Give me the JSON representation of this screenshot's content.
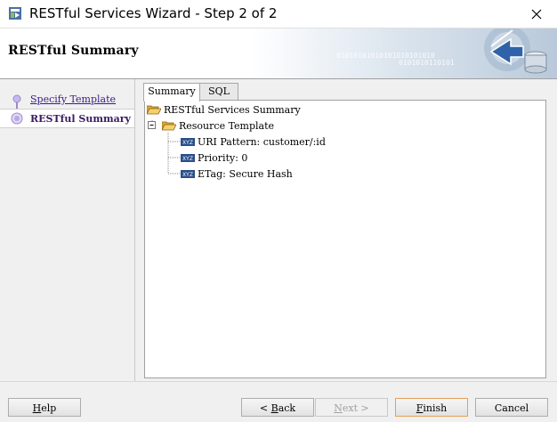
{
  "window": {
    "title": "RESTful Services Wizard - Step 2 of 2",
    "close_icon": "close-x-icon"
  },
  "banner": {
    "heading": "RESTful Summary",
    "binary_line_1": "01010101010101010101010",
    "binary_line_2": "0101010110101"
  },
  "steps": [
    {
      "label": "Specify Template",
      "state": "completed"
    },
    {
      "label": "RESTful Summary",
      "state": "current"
    }
  ],
  "tabs": [
    {
      "label": "Summary",
      "active": true
    },
    {
      "label": "SQL",
      "active": false
    }
  ],
  "tree": {
    "root": {
      "label": "RESTful Services Summary",
      "icon": "folder-open-icon"
    },
    "child": {
      "label": "Resource Template",
      "icon": "folder-open-icon",
      "expanded": true
    },
    "leaves": [
      {
        "label": "URI Pattern: customer/:id",
        "icon": "xyz-property-icon"
      },
      {
        "label": "Priority: 0",
        "icon": "xyz-property-icon"
      },
      {
        "label": "ETag: Secure Hash",
        "icon": "xyz-property-icon"
      }
    ],
    "xyz_icon_text": "XYZ"
  },
  "buttons": {
    "help": {
      "label": "Help",
      "mnemonic": "H",
      "rest": "elp"
    },
    "back": {
      "label": "< Back",
      "prefix": "< ",
      "mnemonic": "B",
      "rest": "ack"
    },
    "next": {
      "label": "Next >",
      "mnemonic": "N",
      "rest": "ext >",
      "enabled": false
    },
    "finish": {
      "label": "Finish",
      "mnemonic": "F",
      "rest": "inish"
    },
    "cancel": {
      "label": "Cancel"
    }
  },
  "colors": {
    "accent_link": "#3a1a8a",
    "folder": "#f2c14e",
    "default_button_border": "#e1a15a"
  }
}
